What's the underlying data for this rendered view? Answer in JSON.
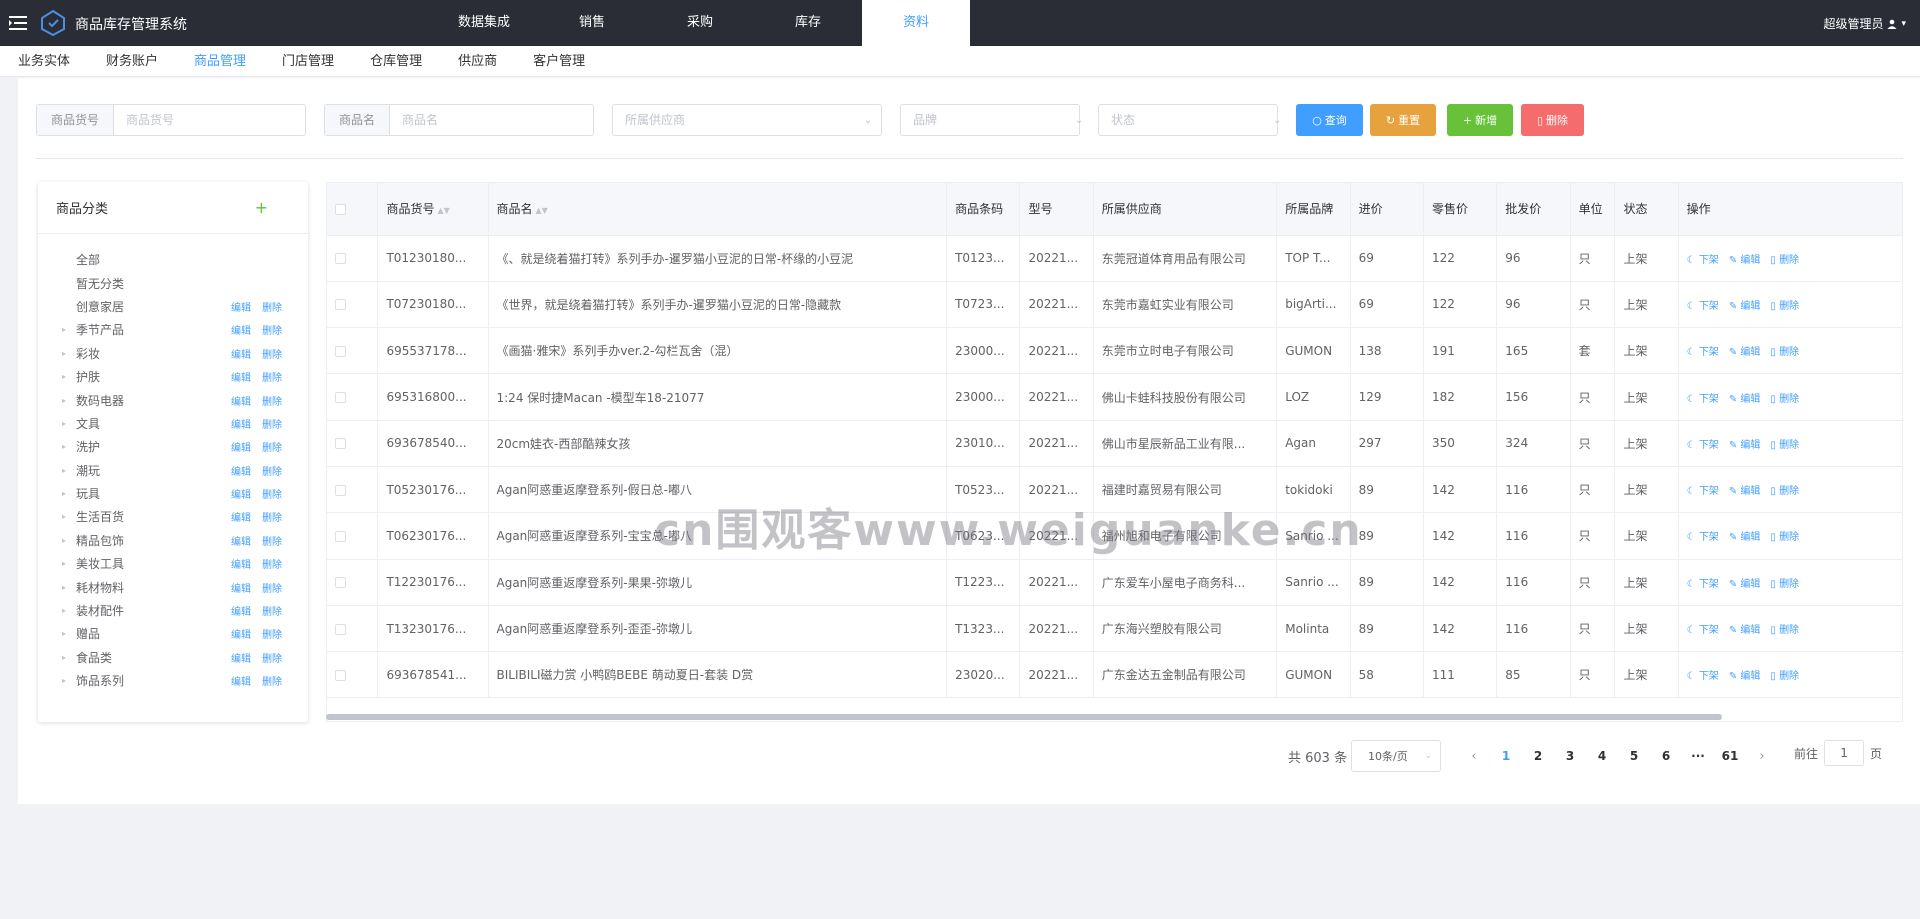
{
  "app": {
    "title": "商品库存管理系统"
  },
  "nav": {
    "items": [
      "数据集成",
      "销售",
      "采购",
      "库存",
      "资料"
    ],
    "active": "资料"
  },
  "user": {
    "name": "超级管理员"
  },
  "subnav": {
    "items": [
      "业务实体",
      "财务账户",
      "商品管理",
      "门店管理",
      "仓库管理",
      "供应商",
      "客户管理"
    ],
    "active": "商品管理"
  },
  "filters": {
    "code_label": "商品货号",
    "code_placeholder": "商品货号",
    "name_label": "商品名",
    "name_placeholder": "商品名",
    "supplier_placeholder": "所属供应商",
    "brand_placeholder": "品牌",
    "status_placeholder": "状态"
  },
  "buttons": {
    "query": "查询",
    "reset": "重置",
    "add": "新增",
    "delete": "删除"
  },
  "categories": {
    "title": "商品分类",
    "edit_label": "编辑",
    "delete_label": "删除",
    "items": [
      {
        "name": "全部",
        "expandable": false,
        "actions": false
      },
      {
        "name": "暂无分类",
        "expandable": false,
        "actions": false
      },
      {
        "name": "创意家居",
        "expandable": false,
        "actions": true
      },
      {
        "name": "季节产品",
        "expandable": true,
        "actions": true
      },
      {
        "name": "彩妆",
        "expandable": true,
        "actions": true
      },
      {
        "name": "护肤",
        "expandable": true,
        "actions": true
      },
      {
        "name": "数码电器",
        "expandable": true,
        "actions": true
      },
      {
        "name": "文具",
        "expandable": true,
        "actions": true
      },
      {
        "name": "洗护",
        "expandable": true,
        "actions": true
      },
      {
        "name": "潮玩",
        "expandable": true,
        "actions": true
      },
      {
        "name": "玩具",
        "expandable": true,
        "actions": true
      },
      {
        "name": "生活百货",
        "expandable": true,
        "actions": true
      },
      {
        "name": "精品包饰",
        "expandable": true,
        "actions": true
      },
      {
        "name": "美妆工具",
        "expandable": true,
        "actions": true
      },
      {
        "name": "耗材物料",
        "expandable": true,
        "actions": true
      },
      {
        "name": "装材配件",
        "expandable": true,
        "actions": true
      },
      {
        "name": "赠品",
        "expandable": true,
        "actions": true
      },
      {
        "name": "食品类",
        "expandable": true,
        "actions": true
      },
      {
        "name": "饰品系列",
        "expandable": true,
        "actions": true
      }
    ]
  },
  "table": {
    "headers": [
      "商品货号",
      "商品名",
      "商品条码",
      "型号",
      "所属供应商",
      "所属品牌",
      "进价",
      "零售价",
      "批发价",
      "单位",
      "状态",
      "操作"
    ],
    "ops": {
      "off_shelf": "下架",
      "edit": "编辑",
      "delete": "删除"
    },
    "rows": [
      [
        "T01230180...",
        "《、就是绕着猫打转》系列手办-暹罗猫小豆泥的日常-杯缘的小豆泥",
        "T0123...",
        "20221...",
        "东莞冠道体育用品有限公司",
        "TOP T...",
        "69",
        "122",
        "96",
        "只",
        "上架"
      ],
      [
        "T07230180...",
        "《世界，就是绕着猫打转》系列手办-暹罗猫小豆泥的日常-隐藏款",
        "T0723...",
        "20221...",
        "东莞市嘉虹实业有限公司",
        "bigArti...",
        "69",
        "122",
        "96",
        "只",
        "上架"
      ],
      [
        "695537178...",
        "《画猫·雅宋》系列手办ver.2-勾栏瓦舍（混）",
        "23000...",
        "20221...",
        "东莞市立时电子有限公司",
        "GUMON",
        "138",
        "191",
        "165",
        "套",
        "上架"
      ],
      [
        "695316800...",
        "1:24 保时捷Macan -模型车18-21077",
        "23000...",
        "20221...",
        "佛山卡蛙科技股份有限公司",
        "LOZ",
        "129",
        "182",
        "156",
        "只",
        "上架"
      ],
      [
        "693678540...",
        "20cm娃衣-西部酷辣女孩",
        "23010...",
        "20221...",
        "佛山市星辰新品工业有限...",
        "Agan",
        "297",
        "350",
        "324",
        "只",
        "上架"
      ],
      [
        "T05230176...",
        "Agan阿惑重返摩登系列-假日总-嘟八",
        "T0523...",
        "20221...",
        "福建时嘉贸易有限公司",
        "tokidoki",
        "89",
        "142",
        "116",
        "只",
        "上架"
      ],
      [
        "T06230176...",
        "Agan阿惑重返摩登系列-宝宝总-嘟八",
        "T0623...",
        "20221...",
        "福州旭和电子有限公司",
        "Sanrio ...",
        "89",
        "142",
        "116",
        "只",
        "上架"
      ],
      [
        "T12230176...",
        "Agan阿惑重返摩登系列-果果-弥墩儿",
        "T1223...",
        "20221...",
        "广东爱车小屋电子商务科...",
        "Sanrio ...",
        "89",
        "142",
        "116",
        "只",
        "上架"
      ],
      [
        "T13230176...",
        "Agan阿惑重返摩登系列-歪歪-弥墩儿",
        "T1323...",
        "20221...",
        "广东海兴塑胶有限公司",
        "Molinta",
        "89",
        "142",
        "116",
        "只",
        "上架"
      ],
      [
        "693678541...",
        "BILIBILI磁力赏 小鸭鸥BEBE 萌动夏日-套装 D赏",
        "23020...",
        "20221...",
        "广东金达五金制品有限公司",
        "GUMON",
        "58",
        "111",
        "85",
        "只",
        "上架"
      ]
    ]
  },
  "pagination": {
    "total": "共 603 条",
    "page_size": "10条/页",
    "pages": [
      "1",
      "2",
      "3",
      "4",
      "5",
      "6",
      "···",
      "61"
    ],
    "current": "1",
    "goto_label": "前往",
    "goto_value": "1",
    "goto_suffix": "页"
  },
  "watermark": "cn围观客www.weiguanke.cn"
}
